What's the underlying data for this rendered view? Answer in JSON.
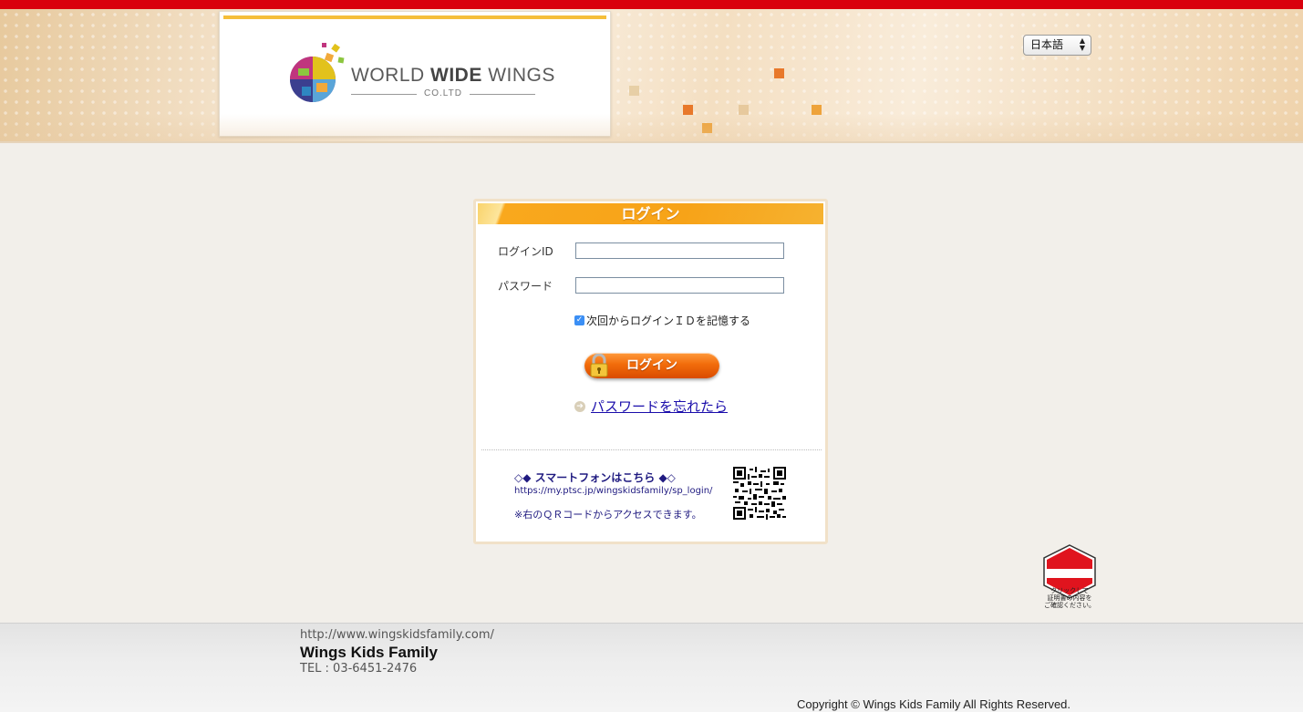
{
  "header": {
    "logo_main": "WORLD",
    "logo_bold": "WIDE",
    "logo_end": "WINGS",
    "logo_sub": "CO.LTD",
    "language": "日本語"
  },
  "login": {
    "title": "ログイン",
    "id_label": "ログインID",
    "id_value": "",
    "password_label": "パスワード",
    "password_value": "",
    "remember_label": "次回からログインＩＤを記憶する",
    "remember_checked": true,
    "login_button": "ログイン",
    "forgot_link": "パスワードを忘れたら",
    "smartphone_title": "◇◆ スマートフォンはこちら ◆◇",
    "smartphone_url": "https://my.ptsc.jp/wingskidsfamily/sp_login/",
    "smartphone_note": "※右のＱＲコードからアクセスできます。"
  },
  "secom": {
    "caption_1": "クリックして",
    "caption_2": "証明書の内容を",
    "caption_3": "ご確認ください。"
  },
  "footer": {
    "url": "http://www.wingskidsfamily.com/",
    "company": "Wings Kids Family",
    "tel": "TEL : 03-6451-2476",
    "copyright": "Copyright © Wings Kids Family All Rights Reserved."
  },
  "colors": {
    "top_bar": "#d9000d",
    "accent_orange": "#f7a318",
    "link_blue": "#1a0dab",
    "navy_text": "#1f1a80"
  }
}
